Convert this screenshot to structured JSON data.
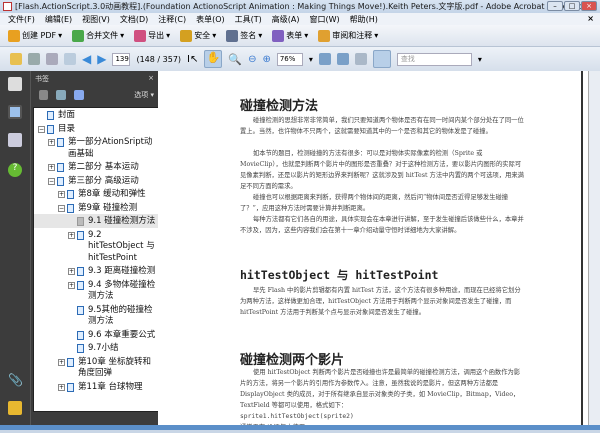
{
  "window": {
    "title": "[Flash.ActionScript.3.0动画教程].(Foundation ActionoScript Animation : Making Things Move!).Keith Peters.文字版.pdf - Adobe Acrobat Professional"
  },
  "menu": [
    "文件(F)",
    "编辑(E)",
    "视图(V)",
    "文档(D)",
    "注释(C)",
    "表单(O)",
    "工具(T)",
    "高级(A)",
    "窗口(W)",
    "帮助(H)"
  ],
  "menu_close": "×",
  "toolbar1": [
    {
      "label": "创建 PDF",
      "color": "#e8a020"
    },
    {
      "label": "合并文件",
      "color": "#4aa84a"
    },
    {
      "label": "导出",
      "color": "#d05080"
    },
    {
      "label": "安全",
      "color": "#d4a020"
    },
    {
      "label": "签名",
      "color": "#607090"
    },
    {
      "label": "表单",
      "color": "#8060c0"
    },
    {
      "label": "审阅和注释",
      "color": "#e0a030"
    }
  ],
  "toolbar2": {
    "page": "139",
    "page_count": "(148 / 357)",
    "zoom": "76%",
    "find_placeholder": "查找"
  },
  "bookmarks": {
    "title": "书签",
    "close": "×",
    "options": "选项 ▾",
    "items": [
      {
        "level": 0,
        "exp": "",
        "label": "封面"
      },
      {
        "level": 0,
        "exp": "⊟",
        "label": "目录"
      },
      {
        "level": 1,
        "exp": "⊞",
        "label": "第一部分AtionSript动画基础"
      },
      {
        "level": 1,
        "exp": "⊞",
        "label": "第二部分 基本运动"
      },
      {
        "level": 1,
        "exp": "⊟",
        "label": "第三部分 高级运动"
      },
      {
        "level": 2,
        "exp": "⊞",
        "label": "第8章 缓动和弹性"
      },
      {
        "level": 2,
        "exp": "⊟",
        "label": "第9章 碰撞检测"
      },
      {
        "level": 3,
        "exp": "",
        "label": "9.1 碰撞检测方法",
        "selected": true
      },
      {
        "level": 3,
        "exp": "⊞",
        "label": "9.2 hitTestObject 与 hitTestPoint"
      },
      {
        "level": 3,
        "exp": "⊞",
        "label": "9.3 距离碰撞检测"
      },
      {
        "level": 3,
        "exp": "⊞",
        "label": "9.4 多物体碰撞检测方法"
      },
      {
        "level": 3,
        "exp": "",
        "label": "9.5其他的碰撞检测方法"
      },
      {
        "level": 3,
        "exp": "",
        "label": "9.6 本章重要公式"
      },
      {
        "level": 3,
        "exp": "",
        "label": "9.7小结"
      },
      {
        "level": 2,
        "exp": "⊞",
        "label": "第10章 坐标旋转和角度回弹"
      },
      {
        "level": 2,
        "exp": "⊞",
        "label": "第11章 台球物理"
      }
    ]
  },
  "document": {
    "h1": "碰撞检测方法",
    "p1": "碰撞检测的思想非常非常简单，我们只要知道两个物体是否有在同一时间内某个部分处在了同一位置上。当然，也许物体不只两个，这就需要知道其中的一个是否和其它的物体发是了碰撞。",
    "p2": "如本节的题目，检测碰撞的方法有很多：可以是对物体实际像素的检测（Sprite 或 MovieClip），也就是判断两个影片中的图形是否重叠？对于这种检测方法，要以影片内图形的实际可见像素判断，还是以影片的矩形边界来判断呢？这就涉及到 hitTest 方法中内置的两个可选项，用来满足不同方面的需求。",
    "p3": "碰撞也可以根据距离来判断，获得两个物体间的距离，然后问“物体间是否近得足够发生碰撞了？”，应用这种方法时需要计算并判断距离。",
    "p4": "每种方法都有它们各自的用途，具体实现会在本章进行讲解，至于发生碰撞后该做些什么，本章并不涉及，因为，这些内容我们会在第十一章介绍动量守恒时详细地为大家讲解。",
    "h2": "hitTestObject 与 hitTestPoint",
    "p5": "早先 Flash 中的影片剪辑都有内置 hitTest 方法，这个方法有很多种用途，而现在已经将它划分为两种方法，这样做更加合理，hitTestObject 方法用于判断两个显示对象间是否发生了碰撞，而 hitTestPoint 方法用于判断某个点与显示对象间是否发生了碰撞。",
    "h3": "碰撞检测两个影片",
    "p6": "使用 hitTestObject 判断两个影片是否碰撞也许是最简单的碰撞检测方法，调用这个函数作为影片的方法，将另一个影片的引用作为参数传入。注意，虽然我说的是影片，但这两种方法都是 DisplayObject 类的成员，对于所有继承自显示对象类的子类，如 MovieClip，Bitmap，Video，TextField 等都可以使用，格式如下：",
    "code": "sprite1.hitTestObject(sprite2)",
    "p7": "通常于在 if 语句中使用"
  }
}
